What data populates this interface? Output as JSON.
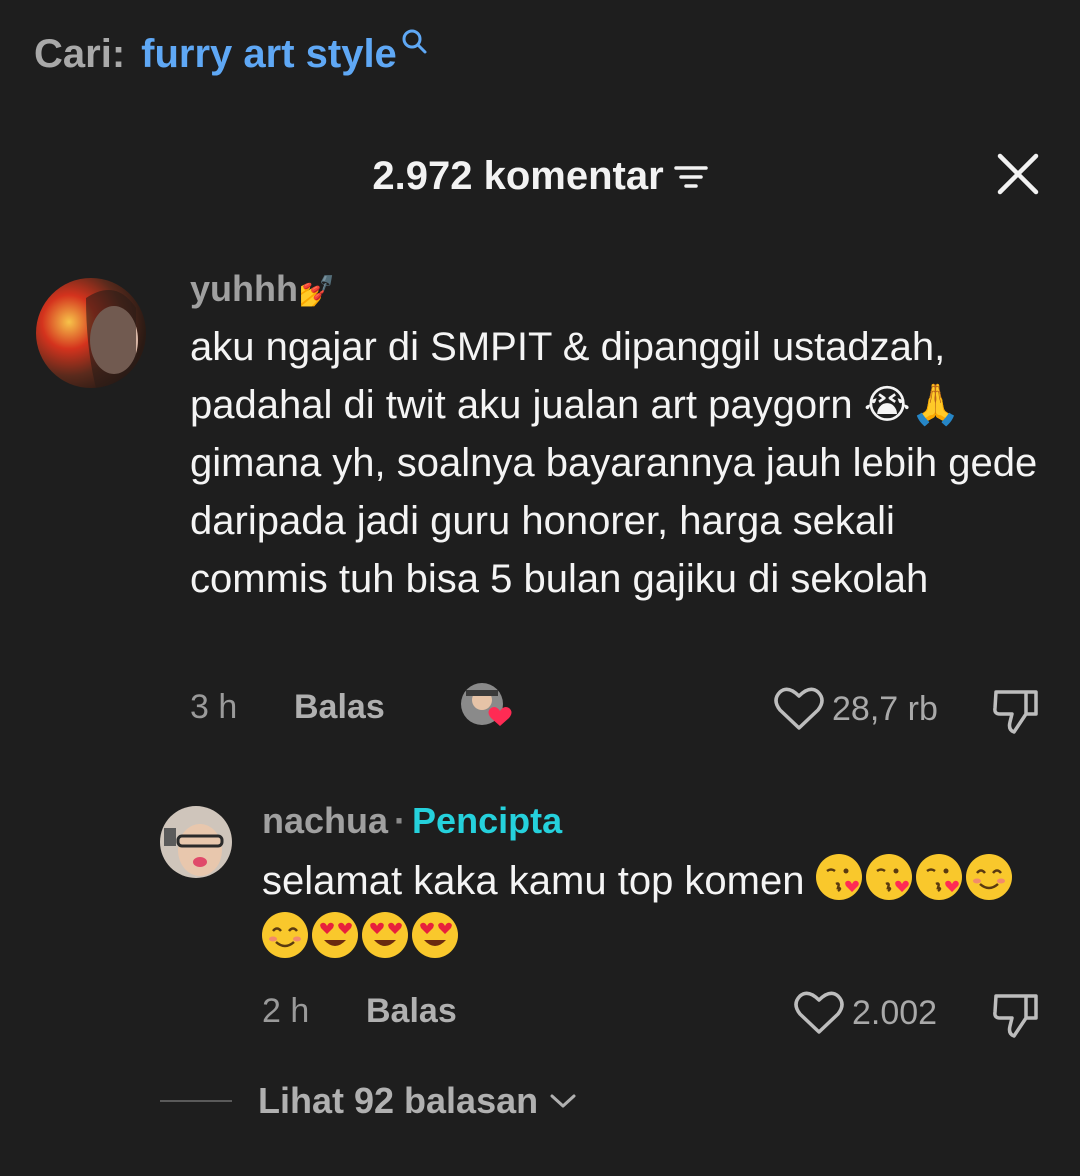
{
  "search": {
    "prefix": "Cari:",
    "term": "furry art style"
  },
  "header": {
    "comment_count": "2.972 komentar"
  },
  "comments": [
    {
      "username": "yuhhh",
      "text": "aku ngajar di SMPIT & dipanggil ustadzah, padahal di twit aku jualan art paygorn 😭🙏 gimana yh, soalnya bayarannya jauh lebih gede daripada jadi guru honorer, harga sekali commis tuh bisa 5 bulan gajiku di sekolah",
      "time": "3 h",
      "reply_label": "Balas",
      "likes": "28,7 rb"
    }
  ],
  "reply": {
    "username": "nachua",
    "badge": "Pencipta",
    "text": "selamat kaka kamu top komen",
    "emojis": [
      "kissing-heart-emoji",
      "kissing-heart-emoji",
      "kissing-heart-emoji",
      "smile-emoji",
      "smile-emoji",
      "heart-eyes-emoji",
      "heart-eyes-emoji",
      "heart-eyes-emoji"
    ],
    "time": "2 h",
    "reply_label": "Balas",
    "likes": "2.002"
  },
  "view_replies": {
    "label": "Lihat 92 balasan"
  },
  "colors": {
    "background": "#1e1e1e",
    "link": "#5fa8f5",
    "creator": "#25d1dc"
  }
}
